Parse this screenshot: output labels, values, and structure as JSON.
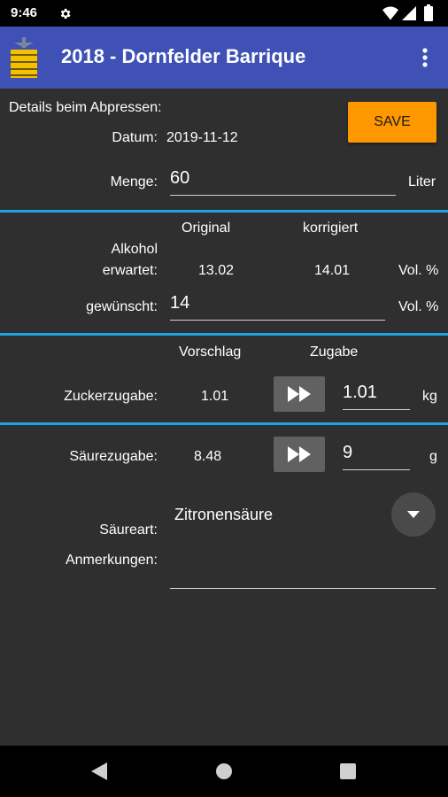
{
  "status_bar": {
    "time": "9:46",
    "icons": [
      "gear-icon",
      "wifi-icon",
      "signal-icon",
      "battery-icon"
    ]
  },
  "app_bar": {
    "title": "2018 - Dornfelder Barrique",
    "icon": "wine-barrel-icon",
    "menu_icon": "more-vert-icon",
    "color": "#3f51b5"
  },
  "header": {
    "details_label": "Details beim Abpressen:",
    "save_label": "SAVE",
    "save_color": "#ff9800",
    "datum_label": "Datum:",
    "datum_value": "2019-11-12",
    "menge_label": "Menge:",
    "menge_value": "60",
    "menge_unit": "Liter"
  },
  "alcohol": {
    "col_original": "Original",
    "col_corrected": "korrigiert",
    "label_line1": "Alkohol",
    "label_line2": "erwartet:",
    "original_value": "13.02",
    "corrected_value": "14.01",
    "unit": "Vol. %",
    "desired_label": "gewünscht:",
    "desired_value": "14",
    "desired_unit": "Vol. %"
  },
  "sugar": {
    "col_suggestion": "Vorschlag",
    "col_addition": "Zugabe",
    "label": "Zuckerzugabe:",
    "suggestion": "1.01",
    "addition": "1.01",
    "unit": "kg"
  },
  "acid": {
    "label": "Säurezugabe:",
    "suggestion": "8.48",
    "addition": "9",
    "unit": "g",
    "type_label": "Säureart:",
    "type_value": "Zitronensäure",
    "notes_label": "Anmerkungen:",
    "notes_value": ""
  },
  "accent_color": "#1ea3e6"
}
